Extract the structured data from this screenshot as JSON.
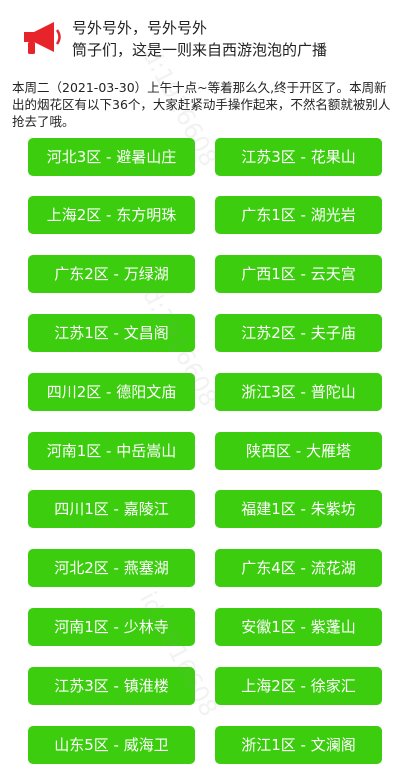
{
  "header": {
    "icon": "megaphone-icon",
    "line1": "号外号外，号外号外",
    "line2": "筒子们，这是一则来自西游泡泡的广播"
  },
  "intro_text": "本周二（2021-03-30）上午十点~等着那么久,终于开区了。本周新出的烟花区有以下36个，大家赶紧动手操作起来，不然名额就被别人抢去了哦。",
  "watermark": "id:1916608",
  "colors": {
    "button_bg": "#3ccd0f",
    "button_text": "#ffffff",
    "icon_red": "#e8242b"
  },
  "regions": [
    {
      "left": "河北3区 - 避暑山庄",
      "right": "江苏3区 - 花果山"
    },
    {
      "left": "上海2区 - 东方明珠",
      "right": "广东1区 - 湖光岩"
    },
    {
      "left": "广东2区 - 万绿湖",
      "right": "广西1区 - 云天宫"
    },
    {
      "left": "江苏1区 - 文昌阁",
      "right": "江苏2区 - 夫子庙"
    },
    {
      "left": "四川2区 - 德阳文庙",
      "right": "浙江3区 - 普陀山"
    },
    {
      "left": "河南1区 - 中岳嵩山",
      "right": "陕西区 - 大雁塔"
    },
    {
      "left": "四川1区 - 嘉陵江",
      "right": "福建1区 - 朱紫坊"
    },
    {
      "left": "河北2区 - 燕塞湖",
      "right": "广东4区 - 流花湖"
    },
    {
      "left": "河南1区 - 少林寺",
      "right": "安徽1区 - 紫蓬山"
    },
    {
      "left": "江苏3区 - 镇淮楼",
      "right": "上海2区 - 徐家汇"
    },
    {
      "left": "山东5区 - 威海卫",
      "right": "浙江1区 - 文澜阁"
    }
  ]
}
